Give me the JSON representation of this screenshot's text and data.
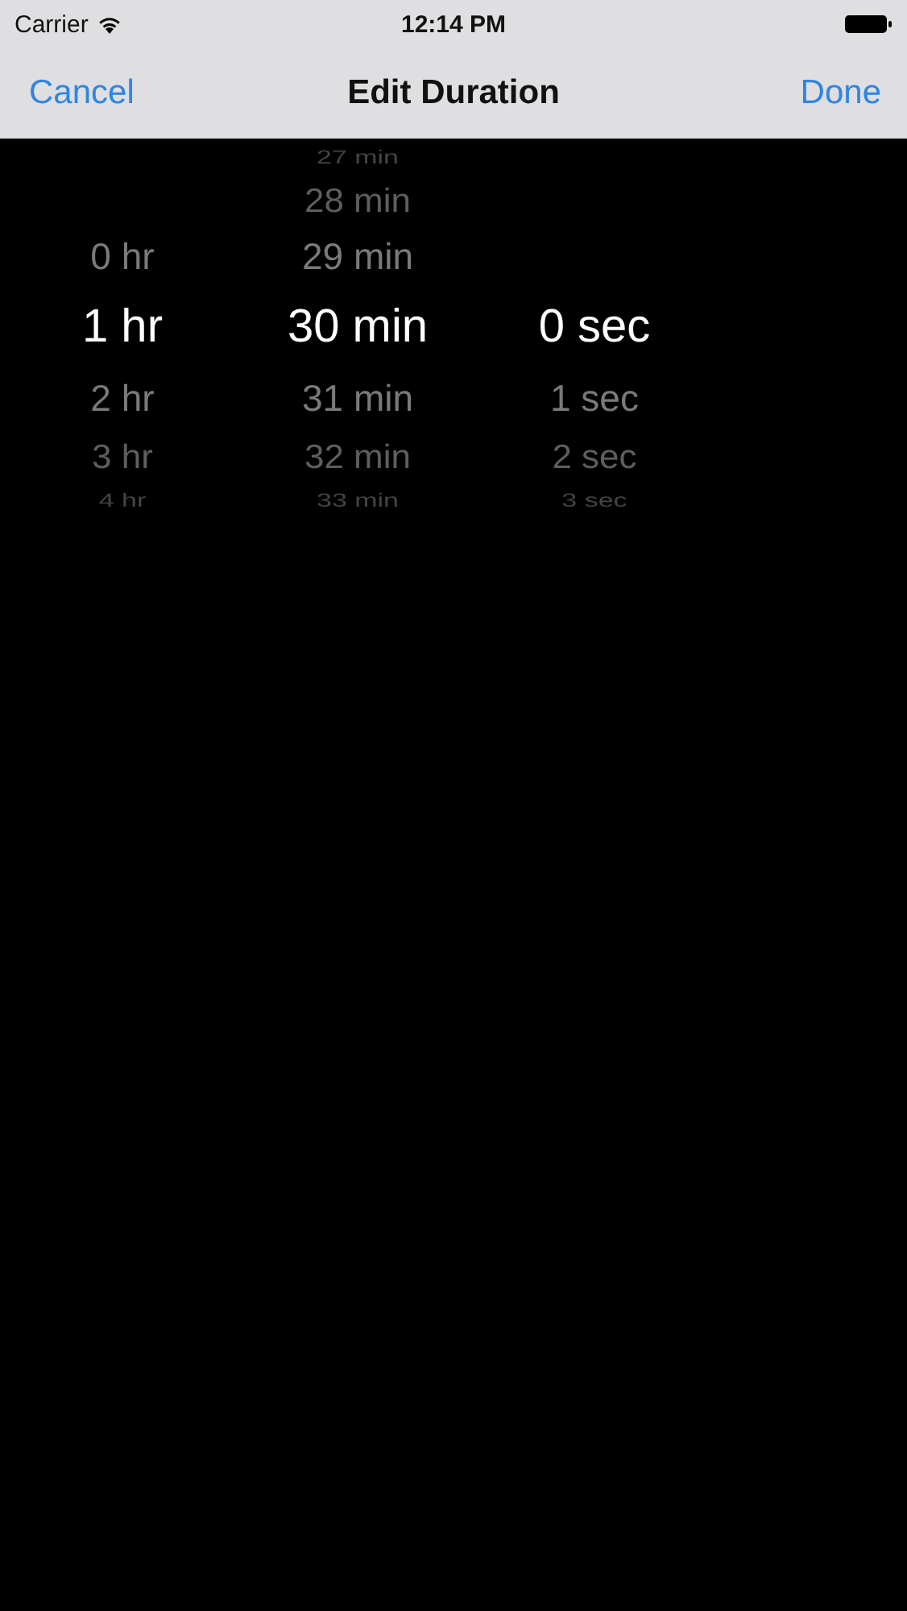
{
  "status_bar": {
    "carrier": "Carrier",
    "time": "12:14 PM"
  },
  "nav_bar": {
    "cancel": "Cancel",
    "title": "Edit Duration",
    "done": "Done"
  },
  "picker": {
    "columns": [
      {
        "items": [
          {
            "label": "0 hr",
            "selected": false
          },
          {
            "label": "1 hr",
            "selected": true
          },
          {
            "label": "2 hr",
            "selected": false
          },
          {
            "label": "3 hr",
            "selected": false
          },
          {
            "label": "4 hr",
            "selected": false
          }
        ]
      },
      {
        "items": [
          {
            "label": "27 min",
            "selected": false
          },
          {
            "label": "28 min",
            "selected": false
          },
          {
            "label": "29 min",
            "selected": false
          },
          {
            "label": "30 min",
            "selected": true
          },
          {
            "label": "31 min",
            "selected": false
          },
          {
            "label": "32 min",
            "selected": false
          },
          {
            "label": "33 min",
            "selected": false
          }
        ]
      },
      {
        "items": [
          {
            "label": "0 sec",
            "selected": true
          },
          {
            "label": "1 sec",
            "selected": false
          },
          {
            "label": "2 sec",
            "selected": false
          },
          {
            "label": "3 sec",
            "selected": false
          }
        ]
      }
    ]
  }
}
